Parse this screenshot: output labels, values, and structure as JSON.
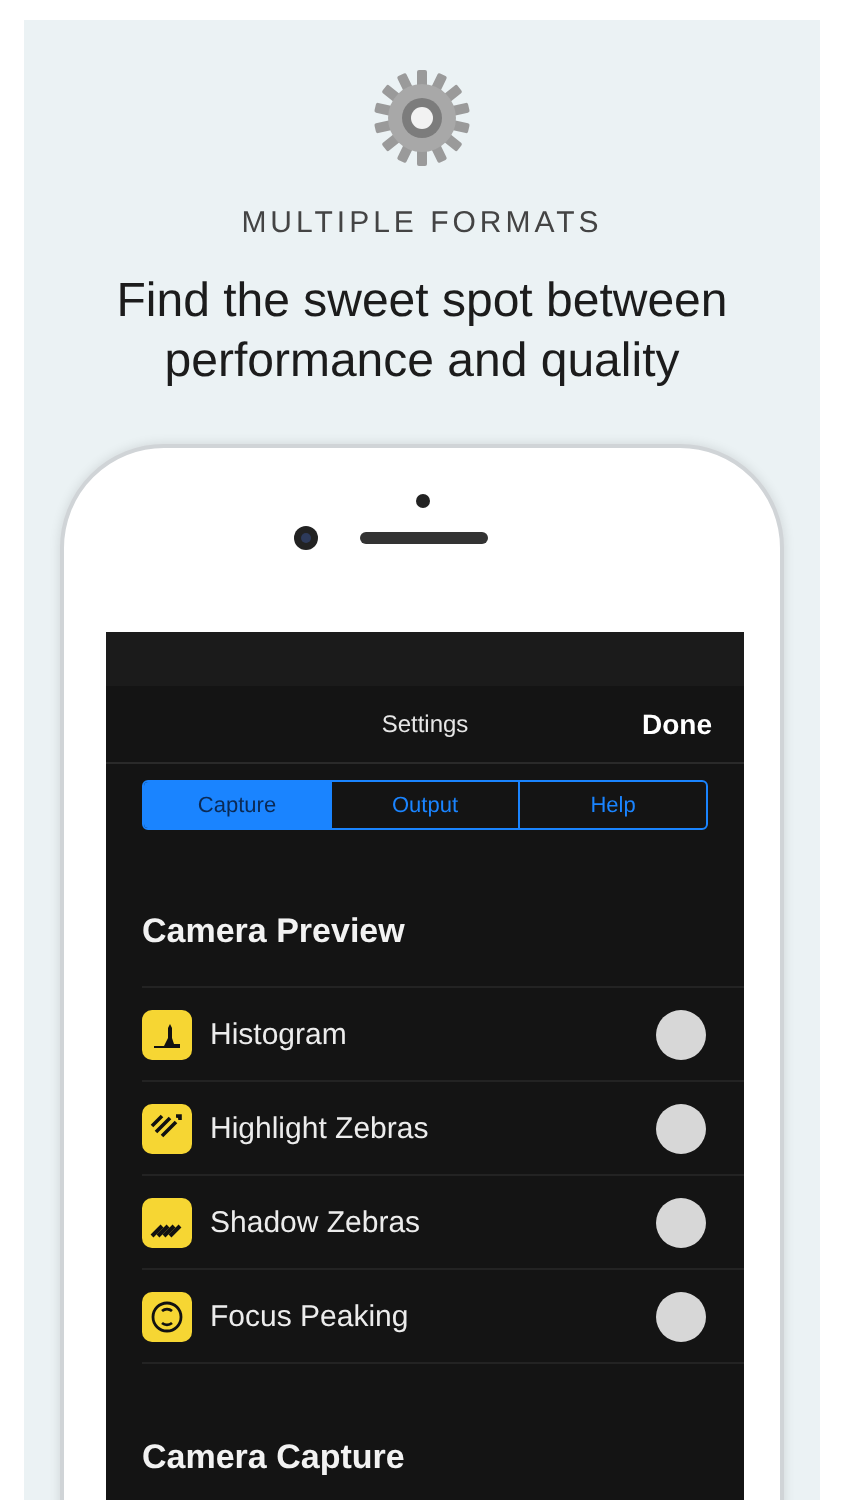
{
  "caption": {
    "eyebrow": "MULTIPLE FORMATS",
    "headline": "Find the sweet spot between performance and quality"
  },
  "app": {
    "nav": {
      "title": "Settings",
      "action": "Done"
    },
    "tabs": [
      {
        "label": "Capture",
        "selected": true
      },
      {
        "label": "Output",
        "selected": false
      },
      {
        "label": "Help",
        "selected": false
      }
    ],
    "sections": [
      {
        "title": "Camera Preview",
        "rows": [
          {
            "label": "Histogram",
            "kind": "histogram",
            "on": false
          },
          {
            "label": "Highlight Zebras",
            "kind": "highlight",
            "on": false
          },
          {
            "label": "Shadow Zebras",
            "kind": "shadow",
            "on": false
          },
          {
            "label": "Focus Peaking",
            "kind": "focus",
            "on": false
          }
        ]
      },
      {
        "title": "Camera Capture"
      }
    ]
  }
}
